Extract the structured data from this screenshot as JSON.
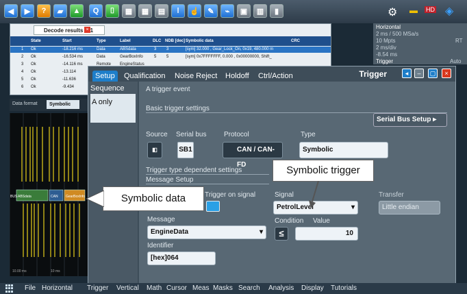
{
  "decode": {
    "tab": "Decode results B 1",
    "headers": [
      "State",
      "Start",
      "Type",
      "Label",
      "DLC",
      "NDB [dec]",
      "Symbolic data",
      "CRC"
    ],
    "rows": [
      [
        "Ok",
        "-18.216 ms",
        "Data",
        "ABSdata",
        "3",
        "3",
        "[sym] 32.000 , Gear_Lock_On, 0x19, 480.000 m"
      ],
      [
        "Ok",
        "-16.534 ms",
        "Data",
        "GearBoxInfo",
        "5",
        "5",
        "[sym] 0x7FFFFFFF, 0.000 , 0x00000000, Shift_"
      ],
      [
        "Ok",
        "-14.116 ms",
        "Remote",
        "EngineStatus",
        "",
        "",
        ""
      ],
      [
        "Ok",
        "-13.114",
        "",
        "",
        "",
        "",
        ""
      ],
      [
        "Ok",
        "-11.636",
        "",
        "",
        "",
        "",
        ""
      ],
      [
        "Ok",
        "-9.434",
        "",
        "",
        "",
        "",
        ""
      ]
    ]
  },
  "horizontal": {
    "title": "Horizontal",
    "line1": "2 ms / 500 MSa/s",
    "line2": "10 Mpts",
    "line3": "2 ms/div",
    "line4": "-8.54 ms",
    "trigger": "Trigger",
    "auto": "Auto",
    "rt": "RT"
  },
  "data_format": {
    "label": "Data format",
    "value": "Symbolic"
  },
  "scope": {
    "bus_label": "BUS",
    "frame1": "ABSdata",
    "frame2": "CAN",
    "frame3": "GearBoxInfo",
    "scale1": "10.00 ms",
    "scale2": "10 ms"
  },
  "dialog": {
    "title": "Trigger",
    "tabs": [
      "Setup",
      "Qualification",
      "Noise Reject",
      "Holdoff",
      "Ctrl/Action"
    ],
    "sequence_label": "Sequence",
    "sequence_item": "A only",
    "event_header": "A trigger event",
    "basic_section": "Basic trigger settings",
    "serial_bus_setup": "Serial Bus Setup",
    "source_label": "Source",
    "serial_bus_label": "Serial bus",
    "serial_bus_value": "SB1",
    "protocol_label": "Protocol",
    "protocol_value": "CAN / CAN-FD",
    "type_label": "Type",
    "type_value": "Symbolic",
    "dependent_section": "Trigger type dependent settings",
    "message_setup": "Message Setup",
    "trigger_on_signal": "Trigger on signal",
    "message_label": "Message",
    "message_value": "EngineData",
    "identifier_label": "Identifier",
    "identifier_value": "[hex]064",
    "signal_label": "Signal",
    "signal_value": "PetrolLevel",
    "transfer_label": "Transfer",
    "transfer_value": "Little endian",
    "condition_label": "Condition",
    "condition_value": "≤",
    "value_label": "Value",
    "value_value": "10"
  },
  "callouts": {
    "symbolic_trigger": "Symbolic trigger",
    "symbolic_data": "Symbolic data"
  },
  "menu": [
    "File",
    "Horizontal",
    "Trigger",
    "Vertical",
    "Math",
    "Cursor",
    "Meas",
    "Masks",
    "Search",
    "Analysis",
    "Display",
    "Tutorials"
  ],
  "colors": {
    "accent": "#1e7ec9",
    "waveform": "#e8d21a",
    "selected_row": "#2a74c4"
  }
}
